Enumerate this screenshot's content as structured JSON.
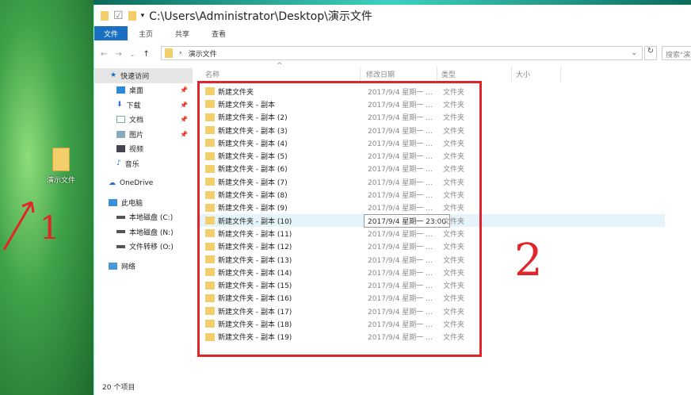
{
  "desktop": {
    "icon_label": "演示文件"
  },
  "annotations": [
    "1",
    "2"
  ],
  "window": {
    "title": "C:\\Users\\Administrator\\Desktop\\演示文件",
    "tabs": [
      "文件",
      "主页",
      "共享",
      "查看"
    ],
    "address": {
      "crumb": "演示文件",
      "search_placeholder": "搜索\"演示文件\""
    },
    "nav": {
      "quick_access": "快速访问",
      "quick_items": [
        "桌面",
        "下载",
        "文档",
        "图片",
        "视频",
        "音乐"
      ],
      "onedrive": "OneDrive",
      "this_pc": "此电脑",
      "drives": [
        "本地磁盘 (C:)",
        "本地磁盘 (N:)",
        "文件转移 (O:)"
      ],
      "network": "网络"
    },
    "columns": [
      "名称",
      "修改日期",
      "类型",
      "大小"
    ],
    "rows": [
      {
        "name": "新建文件夹",
        "date": "2017/9/4 星期一 ...",
        "type": "文件夹"
      },
      {
        "name": "新建文件夹 - 副本",
        "date": "2017/9/4 星期一 ...",
        "type": "文件夹"
      },
      {
        "name": "新建文件夹 - 副本 (2)",
        "date": "2017/9/4 星期一 ...",
        "type": "文件夹"
      },
      {
        "name": "新建文件夹 - 副本 (3)",
        "date": "2017/9/4 星期一 ...",
        "type": "文件夹"
      },
      {
        "name": "新建文件夹 - 副本 (4)",
        "date": "2017/9/4 星期一 ...",
        "type": "文件夹"
      },
      {
        "name": "新建文件夹 - 副本 (5)",
        "date": "2017/9/4 星期一 ...",
        "type": "文件夹"
      },
      {
        "name": "新建文件夹 - 副本 (6)",
        "date": "2017/9/4 星期一 ...",
        "type": "文件夹"
      },
      {
        "name": "新建文件夹 - 副本 (7)",
        "date": "2017/9/4 星期一 ...",
        "type": "文件夹"
      },
      {
        "name": "新建文件夹 - 副本 (8)",
        "date": "2017/9/4 星期一 ...",
        "type": "文件夹"
      },
      {
        "name": "新建文件夹 - 副本 (9)",
        "date": "2017/9/4 星期一 ...",
        "type": "文件夹"
      },
      {
        "name": "新建文件夹 - 副本 (10)",
        "date": "2017/9/4 星期一 23:00",
        "type": "文件夹"
      },
      {
        "name": "新建文件夹 - 副本 (11)",
        "date": "2017/9/4 星期一 ...",
        "type": "文件夹"
      },
      {
        "name": "新建文件夹 - 副本 (12)",
        "date": "2017/9/4 星期一 ...",
        "type": "文件夹"
      },
      {
        "name": "新建文件夹 - 副本 (13)",
        "date": "2017/9/4 星期一 ...",
        "type": "文件夹"
      },
      {
        "name": "新建文件夹 - 副本 (14)",
        "date": "2017/9/4 星期一 ...",
        "type": "文件夹"
      },
      {
        "name": "新建文件夹 - 副本 (15)",
        "date": "2017/9/4 星期一 ...",
        "type": "文件夹"
      },
      {
        "name": "新建文件夹 - 副本 (16)",
        "date": "2017/9/4 星期一 ...",
        "type": "文件夹"
      },
      {
        "name": "新建文件夹 - 副本 (17)",
        "date": "2017/9/4 星期一 ...",
        "type": "文件夹"
      },
      {
        "name": "新建文件夹 - 副本 (18)",
        "date": "2017/9/4 星期一 ...",
        "type": "文件夹"
      },
      {
        "name": "新建文件夹 - 副本 (19)",
        "date": "2017/9/4 星期一 ...",
        "type": "文件夹"
      }
    ],
    "status": "20 个项目"
  }
}
